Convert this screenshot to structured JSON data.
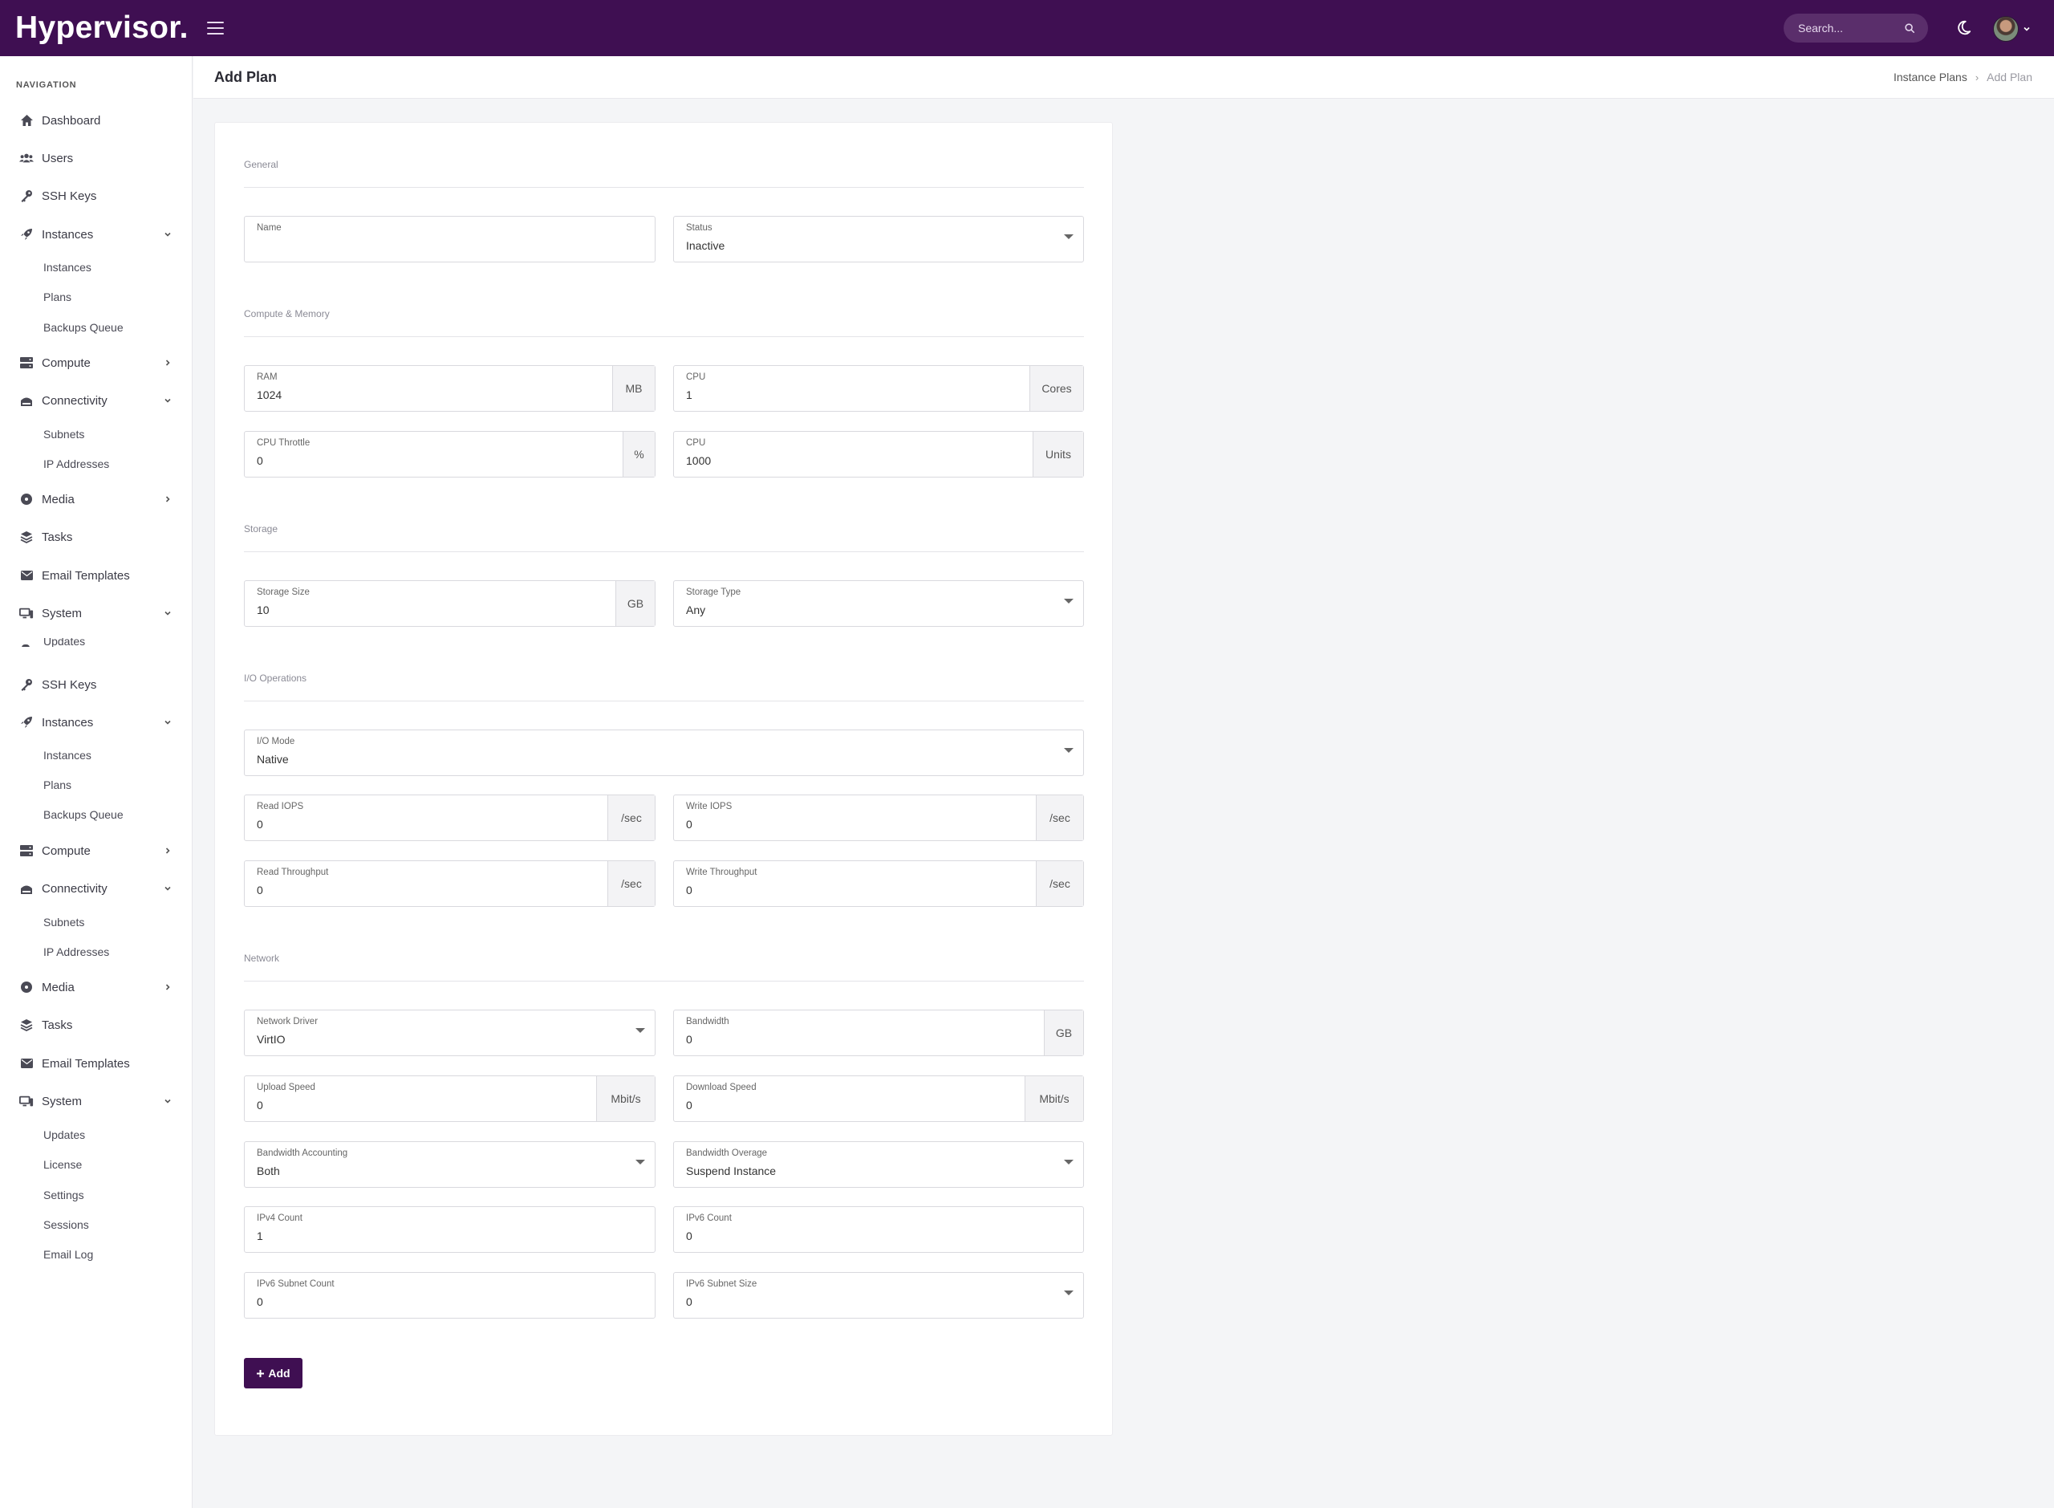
{
  "app": {
    "brand": "Hypervisor.",
    "search_placeholder": "Search..."
  },
  "sidebar": {
    "heading": "NAVIGATION",
    "items": [
      {
        "label": "Dashboard",
        "icon": "home-icon"
      },
      {
        "label": "Users",
        "icon": "users-icon"
      },
      {
        "label": "SSH Keys",
        "icon": "key-icon"
      },
      {
        "label": "Instances",
        "icon": "rocket-icon"
      },
      {
        "label": "Compute",
        "icon": "server-icon"
      },
      {
        "label": "Connectivity",
        "icon": "network-icon"
      },
      {
        "label": "Media",
        "icon": "disc-icon"
      },
      {
        "label": "Tasks",
        "icon": "layers-icon"
      },
      {
        "label": "Email Templates",
        "icon": "envelope-icon"
      },
      {
        "label": "System",
        "icon": "desktop-icon"
      }
    ],
    "sub": {
      "instances": [
        "Instances",
        "Plans",
        "Backups Queue"
      ],
      "connectivity": [
        "Subnets",
        "IP Addresses"
      ],
      "system_partial": "Updates",
      "system": [
        "Updates",
        "License",
        "Settings",
        "Sessions",
        "Email Log"
      ]
    }
  },
  "page": {
    "title": "Add Plan",
    "breadcrumb": [
      "Instance Plans",
      "Add Plan"
    ]
  },
  "form": {
    "sections": {
      "general": "General",
      "compute": "Compute & Memory",
      "storage": "Storage",
      "io": "I/O Operations",
      "network": "Network"
    },
    "name": {
      "label": "Name",
      "value": ""
    },
    "status": {
      "label": "Status",
      "value": "Inactive"
    },
    "ram": {
      "label": "RAM",
      "value": "1024",
      "unit": "MB"
    },
    "cpu_cores": {
      "label": "CPU",
      "value": "1",
      "unit": "Cores"
    },
    "cpu_throttle": {
      "label": "CPU Throttle",
      "value": "0",
      "unit": "%"
    },
    "cpu_units": {
      "label": "CPU",
      "value": "1000",
      "unit": "Units"
    },
    "storage_size": {
      "label": "Storage Size",
      "value": "10",
      "unit": "GB"
    },
    "storage_type": {
      "label": "Storage Type",
      "value": "Any"
    },
    "io_mode": {
      "label": "I/O Mode",
      "value": "Native"
    },
    "read_iops": {
      "label": "Read IOPS",
      "value": "0",
      "unit": "/sec"
    },
    "write_iops": {
      "label": "Write IOPS",
      "value": "0",
      "unit": "/sec"
    },
    "read_throughput": {
      "label": "Read Throughput",
      "value": "0",
      "unit": "/sec"
    },
    "write_throughput": {
      "label": "Write Throughput",
      "value": "0",
      "unit": "/sec"
    },
    "network_driver": {
      "label": "Network Driver",
      "value": "VirtIO"
    },
    "bandwidth": {
      "label": "Bandwidth",
      "value": "0",
      "unit": "GB"
    },
    "upload_speed": {
      "label": "Upload Speed",
      "value": "0",
      "unit": "Mbit/s"
    },
    "download_speed": {
      "label": "Download Speed",
      "value": "0",
      "unit": "Mbit/s"
    },
    "bandwidth_accounting": {
      "label": "Bandwidth Accounting",
      "value": "Both"
    },
    "bandwidth_overage": {
      "label": "Bandwidth Overage",
      "value": "Suspend Instance"
    },
    "ipv4_count": {
      "label": "IPv4 Count",
      "value": "1"
    },
    "ipv6_count": {
      "label": "IPv6 Count",
      "value": "0"
    },
    "ipv6_subnet_count": {
      "label": "IPv6 Subnet Count",
      "value": "0"
    },
    "ipv6_subnet_size": {
      "label": "IPv6 Subnet Size",
      "value": "0"
    },
    "add_button": "Add"
  },
  "colors": {
    "brand": "#3f0f52",
    "background": "#f4f5f7"
  }
}
